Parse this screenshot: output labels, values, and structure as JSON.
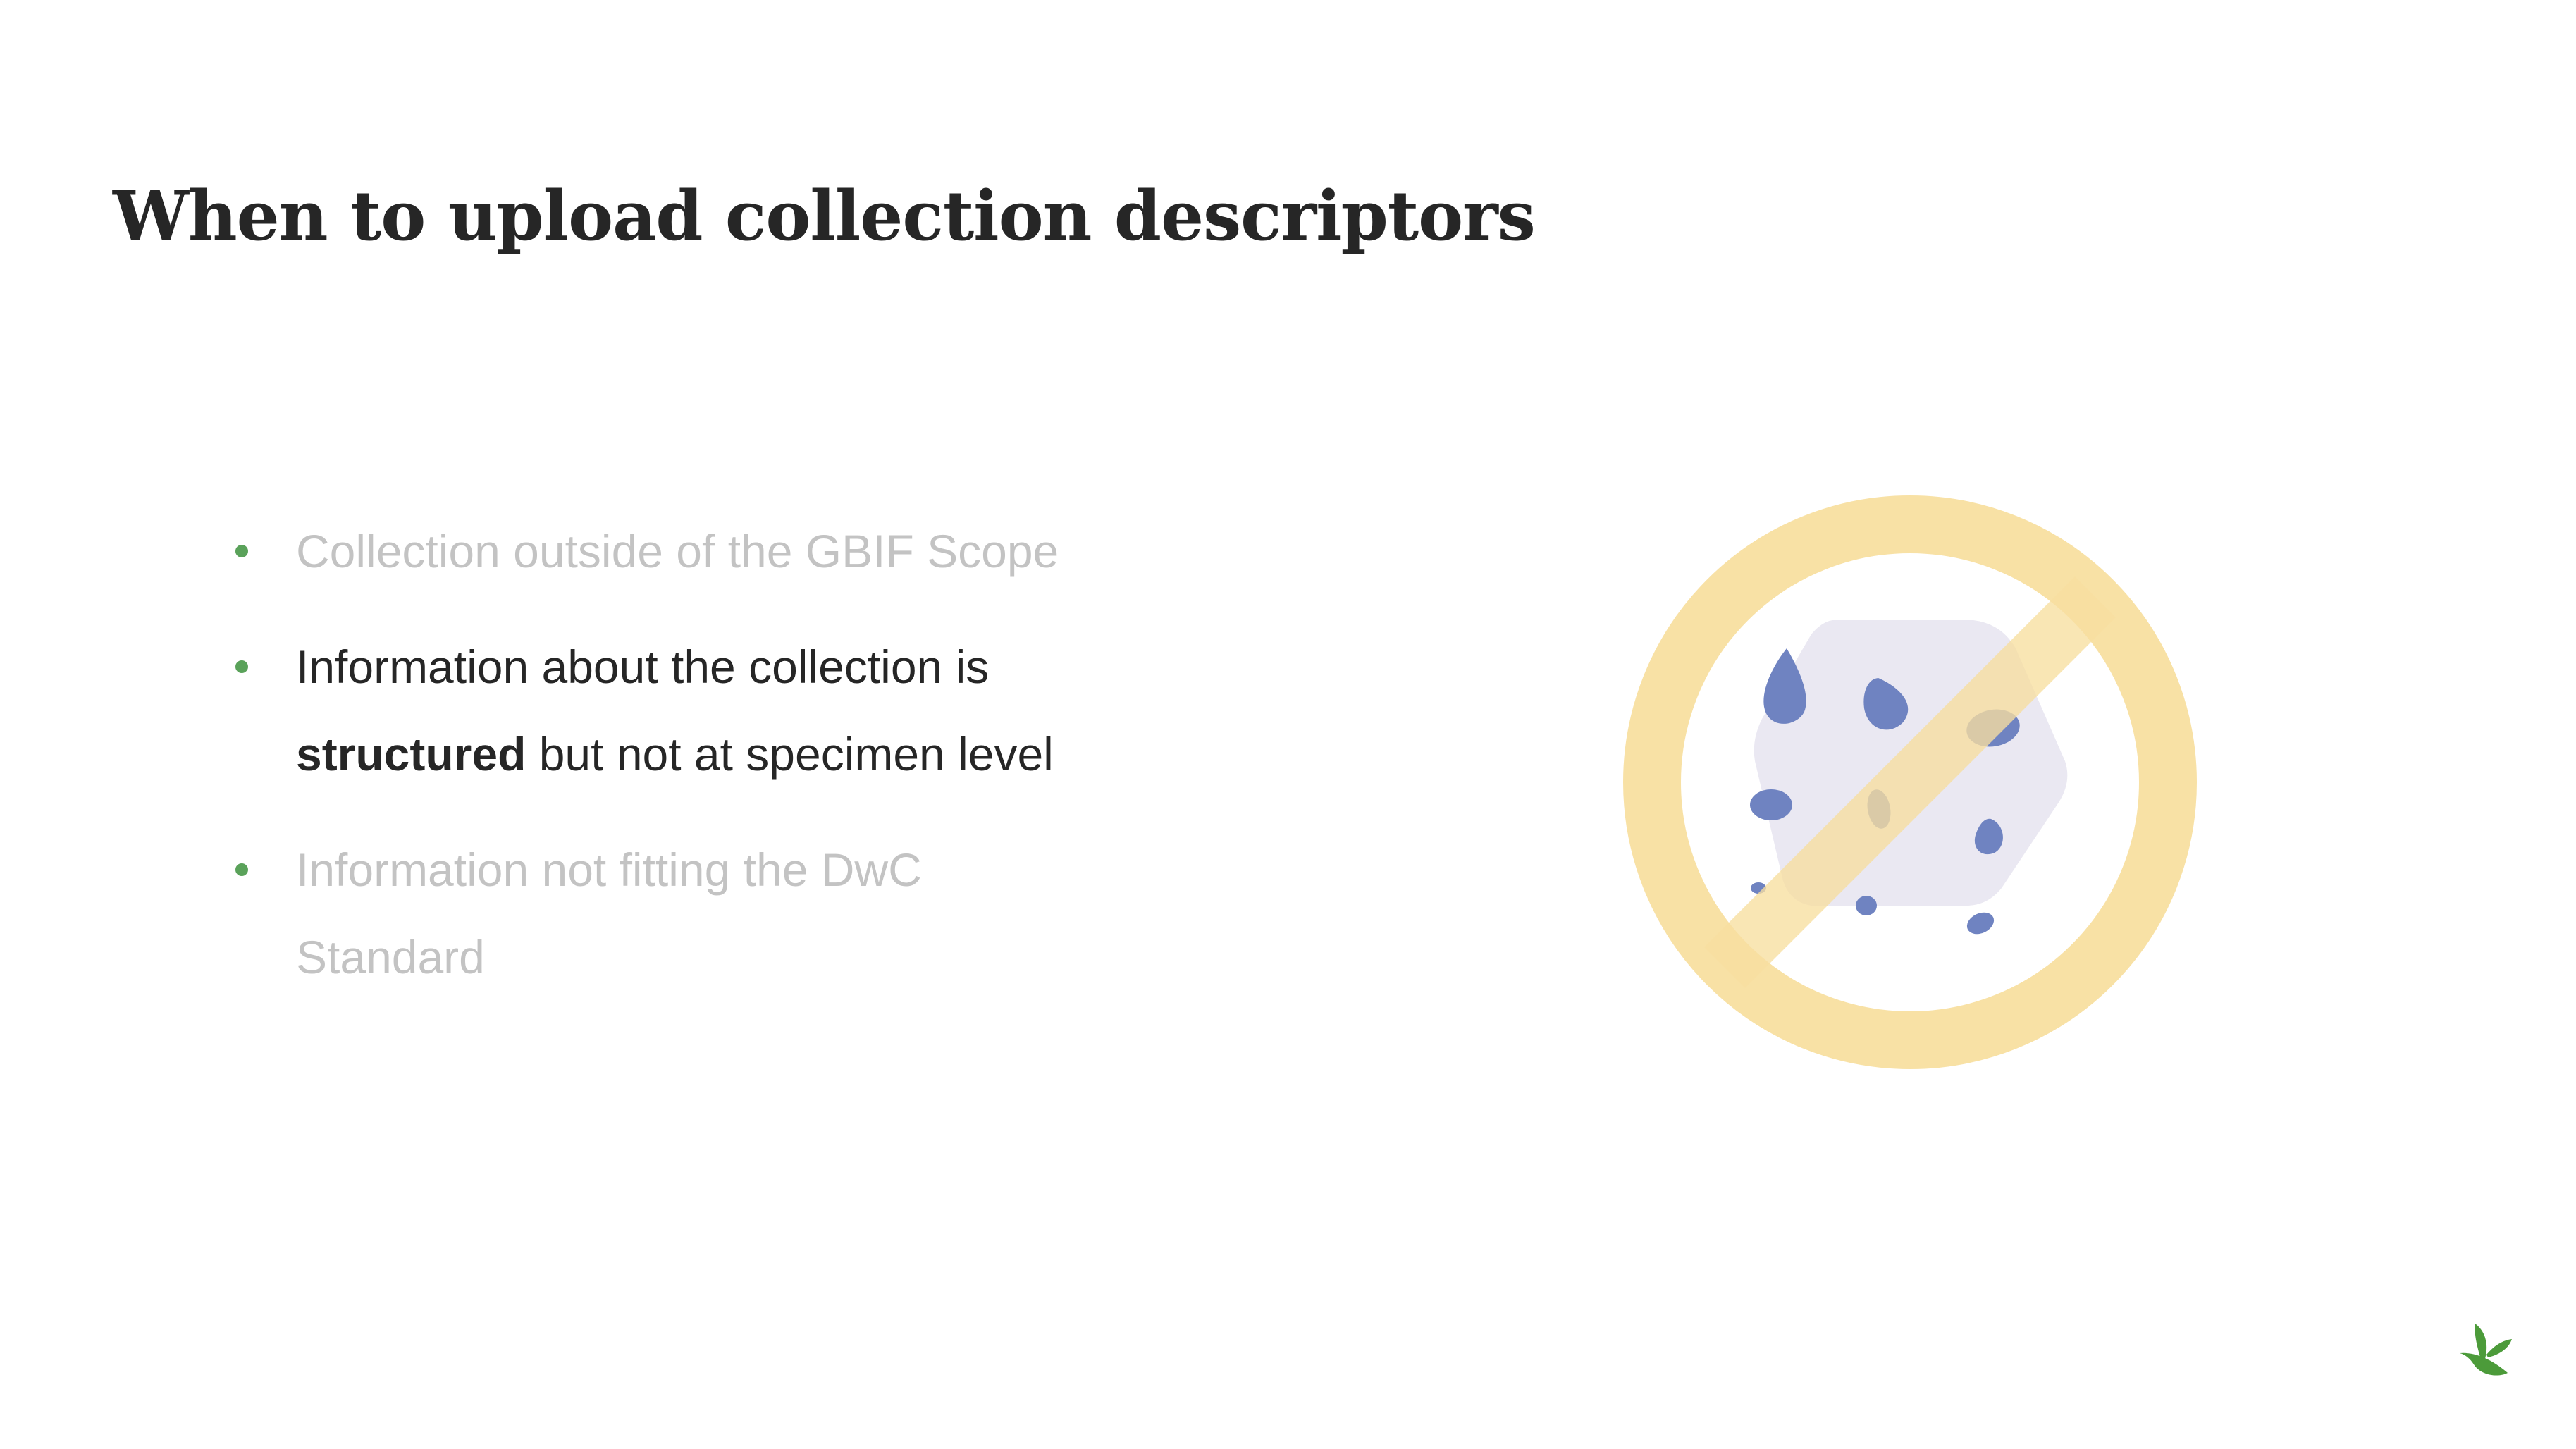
{
  "slide": {
    "title": "When to upload collection descriptors",
    "bullets": [
      {
        "parts": [
          {
            "text": "Collection outside of the GBIF Scope",
            "bold": false
          }
        ],
        "state": "dimmed"
      },
      {
        "parts": [
          {
            "text": "Information about the collection is",
            "bold": false
          },
          {
            "text": "structured",
            "bold": true
          },
          {
            "text": " but not at specimen level",
            "bold": false
          }
        ],
        "state": "active"
      },
      {
        "parts": [
          {
            "text": "Information not fitting the DwC Standard",
            "bold": false
          }
        ],
        "state": "dimmed"
      }
    ],
    "illustration": {
      "icon": "no-data-prohibited-icon",
      "circle_color": "#f8dfa0",
      "blob_color": "#6f83c1",
      "cube_color": "#eae8f2"
    },
    "logo": {
      "icon": "gbif-leaf-icon",
      "color": "#4c9b3a"
    },
    "colors": {
      "bullet_dot": "#5aa25a",
      "text_active": "#262626",
      "text_dimmed": "#c3c3c3"
    }
  }
}
